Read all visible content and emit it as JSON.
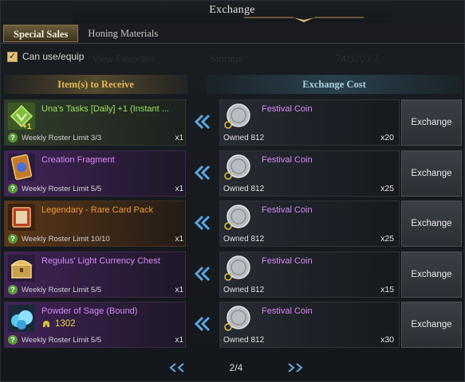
{
  "window": {
    "title": "Exchange"
  },
  "tabs": [
    {
      "label": "Special Sales",
      "active": true
    },
    {
      "label": "Honing Materials",
      "active": false
    }
  ],
  "filter": {
    "can_use_label": "Can use/equip",
    "checked": true
  },
  "headers": {
    "receive": "Item(s) to Receive",
    "cost": "Exchange Cost"
  },
  "rows": [
    {
      "name": "Una's Tasks [Daily] +1 (Instant ...",
      "name_color": "green",
      "icon": "una-task-emblem-icon",
      "icon_badge": "+1",
      "limit": "Weekly Roster Limit 3/3",
      "receive_qty": "x1",
      "cost_name": "Festival Coin",
      "owned": "Owned 812",
      "cost_qty": "x20",
      "button": "Exchange"
    },
    {
      "name": "Creation Fragment",
      "name_color": "purple",
      "icon": "creation-fragment-card-icon",
      "limit": "Weekly Roster Limit 5/5",
      "receive_qty": "x1",
      "cost_name": "Festival Coin",
      "owned": "Owned 812",
      "cost_qty": "x25",
      "button": "Exchange"
    },
    {
      "name": "Legendary - Rare Card Pack",
      "name_color": "orange",
      "icon": "card-pack-book-icon",
      "limit": "Weekly Roster Limit 10/10",
      "receive_qty": "x1",
      "cost_name": "Festival Coin",
      "owned": "Owned 812",
      "cost_qty": "x25",
      "button": "Exchange"
    },
    {
      "name": "Regulus' Light Currency Chest",
      "name_color": "purple",
      "icon": "treasure-chest-icon",
      "limit": "Weekly Roster Limit 5/5",
      "receive_qty": "x1",
      "cost_name": "Festival Coin",
      "owned": "Owned 812",
      "cost_qty": "x15",
      "button": "Exchange"
    },
    {
      "name": "Powder of Sage (Bound)",
      "name_color": "purple",
      "icon": "powder-of-sage-icon",
      "sub_value": "1302",
      "limit": "Weekly Roster Limit 5/5",
      "receive_qty": "x1",
      "cost_name": "Festival Coin",
      "owned": "Owned 812",
      "cost_qty": "x30",
      "button": "Exchange"
    }
  ],
  "pager": {
    "text": "2/4"
  },
  "colors": {
    "accent_gold": "#e3b85a",
    "accent_blue": "#a9d3e2",
    "rare_purple": "#d68af5",
    "task_green": "#9be35a",
    "legend_orange": "#f09a3a"
  }
}
